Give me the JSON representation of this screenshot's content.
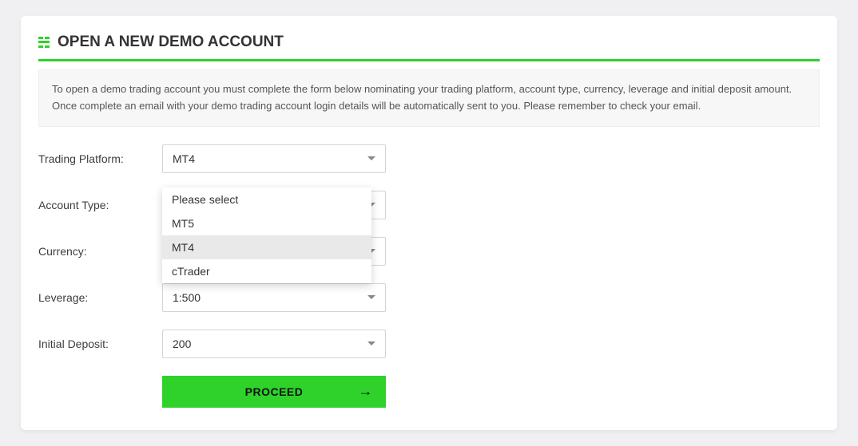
{
  "header": {
    "title": "OPEN A NEW DEMO ACCOUNT"
  },
  "info": {
    "text": "To open a demo trading account you must complete the form below nominating your trading platform, account type, currency, leverage and initial deposit amount. Once complete an email with your demo trading account login details will be automatically sent to you. Please remember to check your email."
  },
  "form": {
    "trading_platform": {
      "label": "Trading Platform:",
      "value": "MT4"
    },
    "account_type": {
      "label": "Account Type:",
      "value": ""
    },
    "currency": {
      "label": "Currency:",
      "value": ""
    },
    "leverage": {
      "label": "Leverage:",
      "value": "1:500"
    },
    "initial_deposit": {
      "label": "Initial Deposit:",
      "value": "200"
    }
  },
  "dropdown": {
    "options": {
      "0": "Please select",
      "1": "MT5",
      "2": "MT4",
      "3": "cTrader"
    },
    "selected_index": 2
  },
  "submit": {
    "label": "PROCEED"
  }
}
